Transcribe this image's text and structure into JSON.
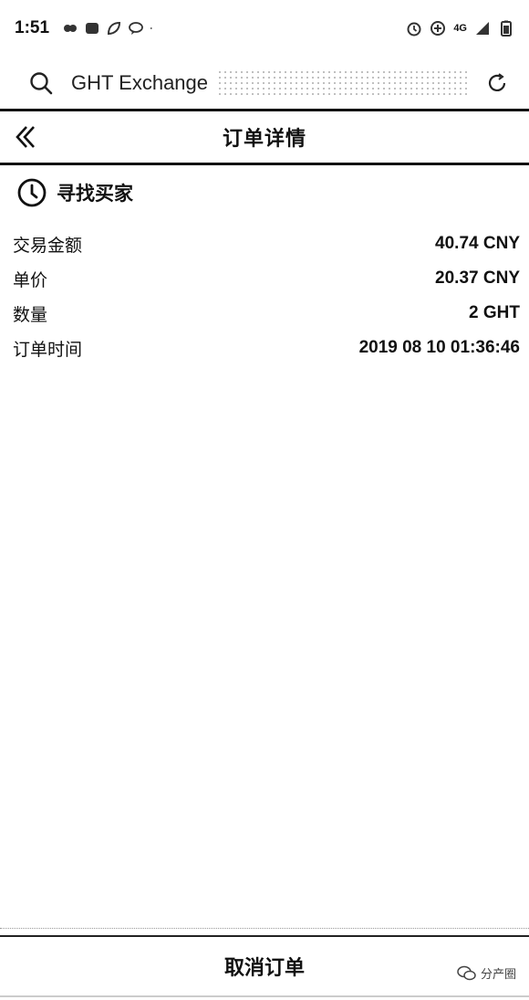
{
  "status_bar": {
    "time": "1:51",
    "network": "4G"
  },
  "browser": {
    "address_text": "GHT Exchange"
  },
  "header": {
    "title": "订单详情"
  },
  "order": {
    "status": "寻找买家",
    "rows": [
      {
        "label": "交易金额",
        "value": "40.74 CNY"
      },
      {
        "label": "单价",
        "value": "20.37 CNY"
      },
      {
        "label": "数量",
        "value": "2 GHT"
      },
      {
        "label": "订单时间",
        "value": "2019 08 10 01:36:46"
      }
    ]
  },
  "footer": {
    "cancel_label": "取消订单",
    "watermark": "分产圈"
  }
}
